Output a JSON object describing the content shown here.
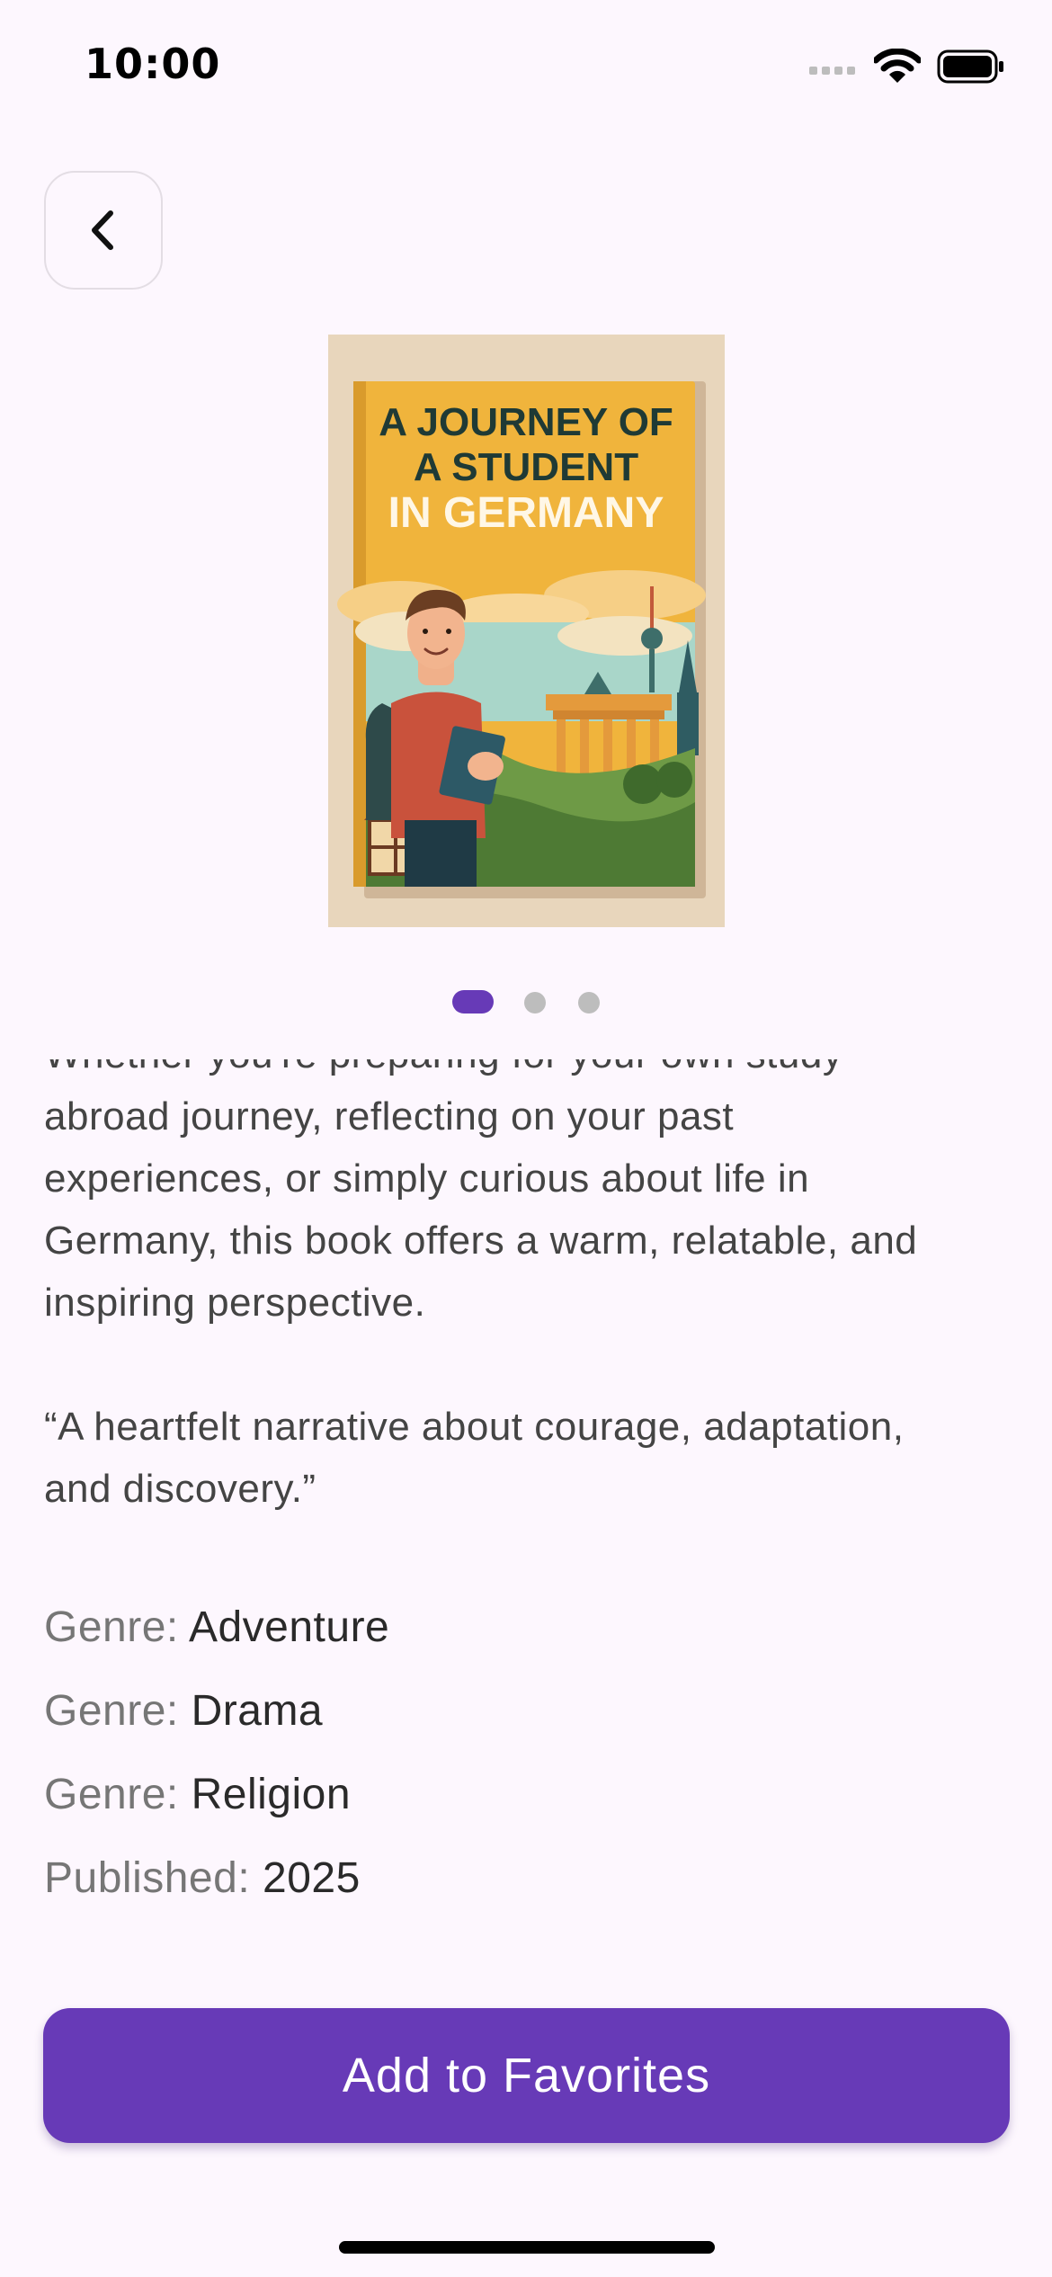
{
  "status_bar": {
    "time": "10:00",
    "icons": [
      "cellular-signal-icon",
      "wifi-icon",
      "battery-icon"
    ]
  },
  "nav": {
    "back_icon": "chevron-left-icon"
  },
  "cover": {
    "title_line1": "A JOURNEY OF",
    "title_line2": "A STUDENT",
    "title_line3": "IN GERMANY"
  },
  "carousel": {
    "pages": 3,
    "active_index": 0
  },
  "description": {
    "paragraph_partial_top": "Whether you're preparing for your own study",
    "paragraph_lines": [
      "abroad journey, reflecting on your past",
      "experiences, or simply curious about life in",
      "Germany, this book offers a warm, relatable, and",
      "inspiring perspective."
    ],
    "quote_lines": [
      "“A heartfelt narrative about courage, adaptation,",
      "and discovery.”"
    ]
  },
  "details": {
    "genre_key": "Genre:",
    "genres": [
      "Adventure",
      "Drama",
      "Religion"
    ],
    "published_key": "Published:",
    "published_value": "2025"
  },
  "actions": {
    "add_favorites_label": "Add to Favorites"
  },
  "colors": {
    "background": "#FDF7FE",
    "accent": "#673AB7",
    "dot_inactive": "#BDBDBD",
    "cover_yellow": "#F0B43C",
    "cover_dark_text": "#1F3A35"
  }
}
